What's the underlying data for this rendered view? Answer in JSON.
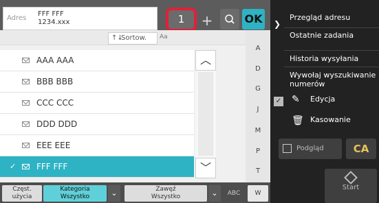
{
  "header": {
    "address_label": "Adres",
    "address_value_line1": "FFF FFF",
    "address_value_line2": "1234.xxx",
    "count_label": "1",
    "ok_label": "OK"
  },
  "sort": {
    "label": "Sortow."
  },
  "list": {
    "items": [
      {
        "label": "AAA AAA"
      },
      {
        "label": "BBB BBB"
      },
      {
        "label": "CCC CCC"
      },
      {
        "label": "DDD DDD"
      },
      {
        "label": "EEE EEE"
      },
      {
        "label": "FFF FFF"
      }
    ]
  },
  "alphabet": [
    "A",
    "D",
    "G",
    "J",
    "M",
    "P",
    "T",
    "W"
  ],
  "bottom": {
    "frequent_label": "Częst. użycia",
    "category_line1": "Kategoria",
    "category_line2": "Wszystko",
    "narrow_line1": "Zawęź",
    "narrow_line2": "Wszystko",
    "abc_label": "ABC"
  },
  "panel": {
    "address_review": "Przegląd adresu",
    "recent_jobs": "Ostatnie zadania",
    "send_history": "Historia wysyłania",
    "global_search": "Wywołaj wyszukiwanie numerów",
    "edit_label": "Edycja",
    "delete_label": "Kasowanie",
    "preview_label": "Podgląd",
    "ca_label": "CA",
    "start_label": "Start"
  },
  "colors": {
    "accent": "#2eb3c4",
    "highlight": "#e0213a",
    "ca": "#e8c35a"
  }
}
